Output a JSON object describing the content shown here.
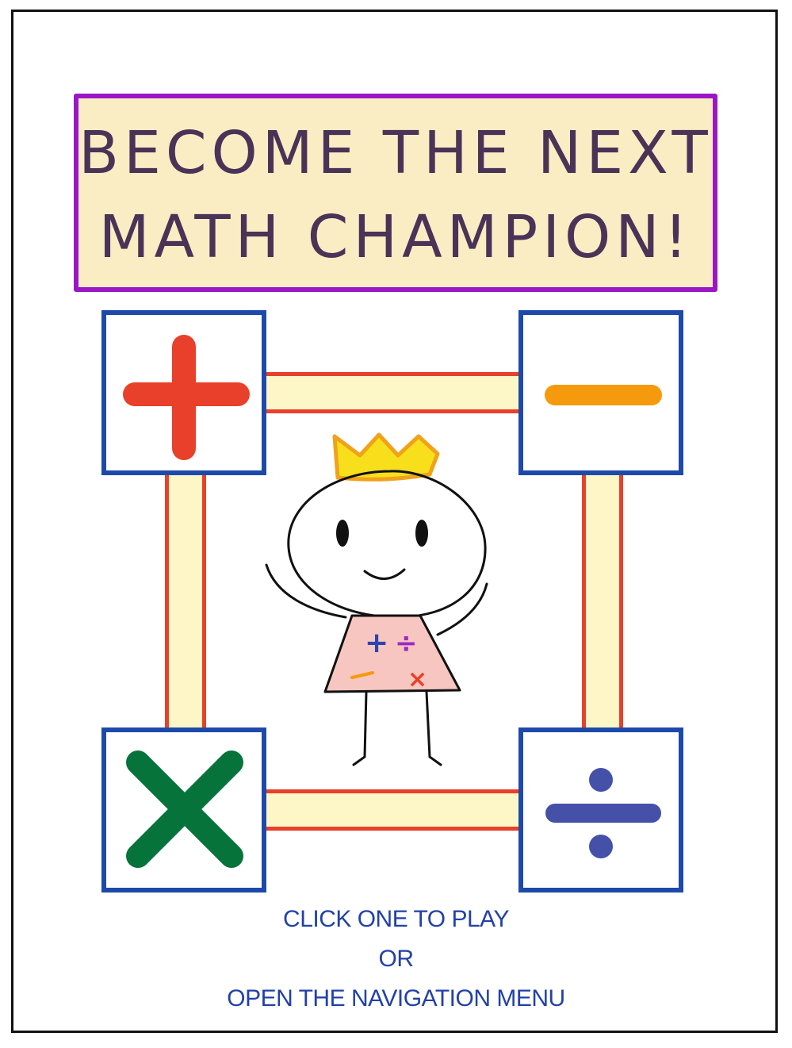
{
  "title": {
    "line1": "BECOME THE NEXT",
    "line2": "MATH CHAMPION!"
  },
  "tiles": [
    {
      "operation": "addition",
      "icon": "plus-icon",
      "color": "#e8402a"
    },
    {
      "operation": "subtraction",
      "icon": "minus-icon",
      "color": "#f59a0c"
    },
    {
      "operation": "multiplication",
      "icon": "times-icon",
      "color": "#06733a"
    },
    {
      "operation": "division",
      "icon": "divide-icon",
      "color": "#4550a8"
    }
  ],
  "mascot": {
    "shirt_symbols": [
      "+",
      "÷",
      "−",
      "×"
    ]
  },
  "instructions": {
    "line1": "CLICK ONE TO PLAY",
    "line2": "OR",
    "line3": "OPEN THE NAVIGATION MENU"
  },
  "colors": {
    "banner_border": "#9a16c6",
    "banner_fill": "#fbedc3",
    "title_text": "#4a3357",
    "tile_border": "#1d4aaa",
    "connector_border": "#e8402a",
    "connector_fill": "#fdf7c8",
    "instructions_text": "#2241a8",
    "crown": "#f8df1c",
    "shirt": "#f8c6c0"
  }
}
